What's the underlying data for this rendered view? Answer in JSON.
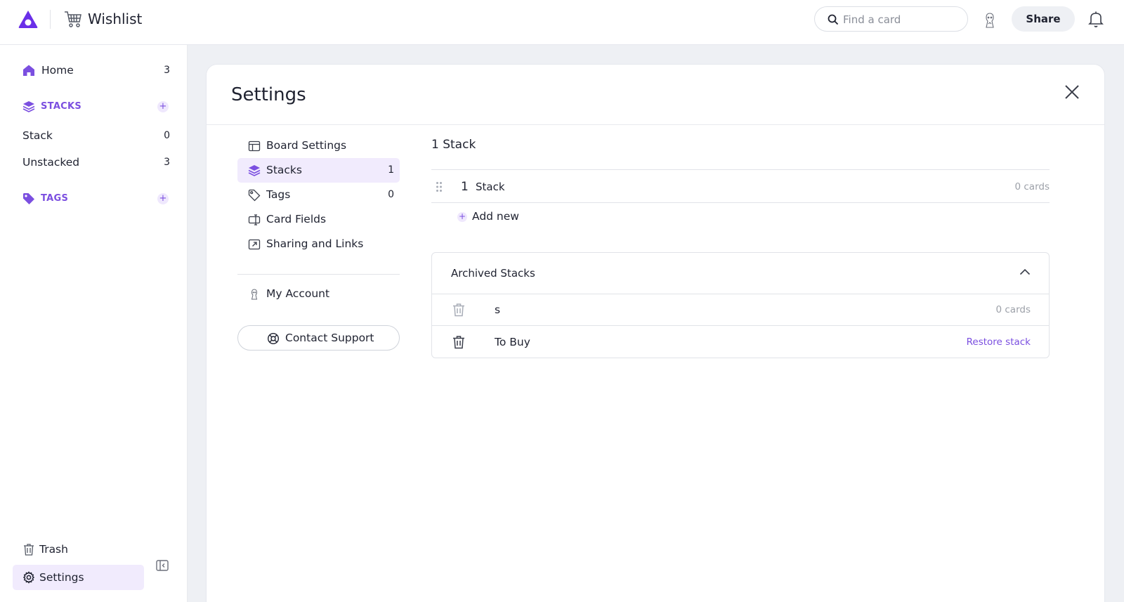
{
  "topbar": {
    "board_title": "Wishlist",
    "search_placeholder": "Find a card",
    "share_label": "Share"
  },
  "sidebar": {
    "home": {
      "label": "Home",
      "count": "3"
    },
    "stacks_section": {
      "label": "STACKS",
      "add": "+"
    },
    "stack_items": [
      {
        "label": "Stack",
        "count": "0"
      },
      {
        "label": "Unstacked",
        "count": "3"
      }
    ],
    "tags_section": {
      "label": "TAGS",
      "add": "+"
    },
    "trash_label": "Trash",
    "settings_label": "Settings"
  },
  "settings": {
    "title": "Settings",
    "nav": {
      "board_settings": "Board Settings",
      "stacks": {
        "label": "Stacks",
        "count": "1"
      },
      "tags": {
        "label": "Tags",
        "count": "0"
      },
      "card_fields": "Card Fields",
      "sharing": "Sharing and Links",
      "my_account": "My Account",
      "contact_support": "Contact Support"
    },
    "content": {
      "title": "1 Stack",
      "stacks": [
        {
          "number": "1",
          "name": "Stack",
          "cards": "0 cards"
        }
      ],
      "add_new": "Add new",
      "plus": "+",
      "archived": {
        "title": "Archived Stacks",
        "items": [
          {
            "name": "s",
            "right": "0 cards"
          },
          {
            "name": "To Buy",
            "right": "Restore stack"
          }
        ]
      }
    }
  },
  "colors": {
    "accent": "#7b4fe0",
    "accent_bg": "#f1ebfd",
    "main_bg": "#eef0f4"
  }
}
